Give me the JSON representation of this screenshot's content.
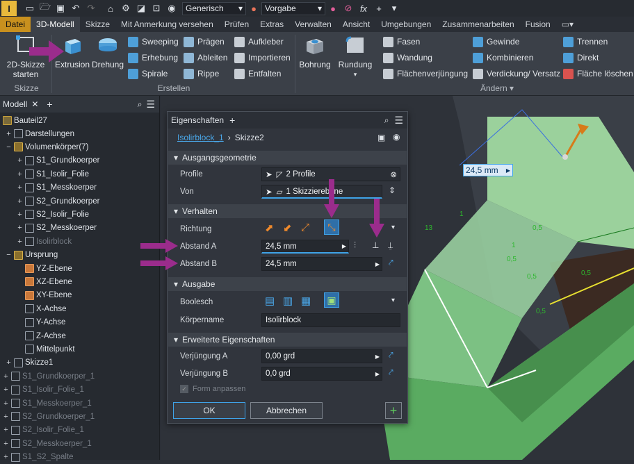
{
  "qat": {
    "logo": "I",
    "style_select": "Generisch",
    "appearance_select": "Vorgabe",
    "fx": "fx"
  },
  "tabs": [
    "Datei",
    "3D-Modell",
    "Skizze",
    "Mit Anmerkung versehen",
    "Prüfen",
    "Extras",
    "Verwalten",
    "Ansicht",
    "Umgebungen",
    "Zusammenarbeiten",
    "Fusion"
  ],
  "ribbon": {
    "skizze": {
      "start_line1": "2D-Skizze",
      "start_line2": "starten",
      "group": "Skizze"
    },
    "erstellen": {
      "extrusion": "Extrusion",
      "drehung": "Drehung",
      "sweeping": "Sweeping",
      "erhebung": "Erhebung",
      "spirale": "Spirale",
      "praegen": "Prägen",
      "ableiten": "Ableiten",
      "rippe": "Rippe",
      "aufkleber": "Aufkleber",
      "importieren": "Importieren",
      "entfalten": "Entfalten",
      "group": "Erstellen"
    },
    "aendern": {
      "bohrung": "Bohrung",
      "rundung": "Rundung",
      "fasen": "Fasen",
      "wandung": "Wandung",
      "flaechenverjuengung": "Flächenverjüngung",
      "gewinde": "Gewinde",
      "kombinieren": "Kombinieren",
      "verdickung": "Verdickung/ Versatz",
      "trennen": "Trennen",
      "direkt": "Direkt",
      "flaeche_loeschen": "Fläche löschen",
      "group": "Ändern"
    }
  },
  "browser": {
    "tab": "Modell",
    "root": "Bauteil27",
    "items": [
      {
        "label": "Darstellungen",
        "level": 1,
        "dim": false
      },
      {
        "label": "Volumenkörper(7)",
        "level": 1,
        "dim": false
      },
      {
        "label": "S1_Grundkoerper",
        "level": 2,
        "dim": false
      },
      {
        "label": "S1_Isolir_Folie",
        "level": 2,
        "dim": false
      },
      {
        "label": "S1_Messkoerper",
        "level": 2,
        "dim": false
      },
      {
        "label": "S2_Grundkoerper",
        "level": 2,
        "dim": false
      },
      {
        "label": "S2_Isolir_Folie",
        "level": 2,
        "dim": false
      },
      {
        "label": "S2_Messkoerper",
        "level": 2,
        "dim": false
      },
      {
        "label": "Isolirblock",
        "level": 2,
        "dim": true
      },
      {
        "label": "Ursprung",
        "level": 1,
        "dim": false
      },
      {
        "label": "YZ-Ebene",
        "level": 2,
        "dim": false
      },
      {
        "label": "XZ-Ebene",
        "level": 2,
        "dim": false
      },
      {
        "label": "XY-Ebene",
        "level": 2,
        "dim": false
      },
      {
        "label": "X-Achse",
        "level": 2,
        "dim": false
      },
      {
        "label": "Y-Achse",
        "level": 2,
        "dim": false
      },
      {
        "label": "Z-Achse",
        "level": 2,
        "dim": false
      },
      {
        "label": "Mittelpunkt",
        "level": 2,
        "dim": false
      },
      {
        "label": "Skizze1",
        "level": 1,
        "dim": false
      },
      {
        "label": "S1_Grundkoerper_1",
        "level": 0,
        "dim": true
      },
      {
        "label": "S1_Isolir_Folie_1",
        "level": 0,
        "dim": true
      },
      {
        "label": "S1_Messkoerper_1",
        "level": 0,
        "dim": true
      },
      {
        "label": "S2_Grundkoerper_1",
        "level": 0,
        "dim": true
      },
      {
        "label": "S2_Isolir_Folie_1",
        "level": 0,
        "dim": true
      },
      {
        "label": "S2_Messkoerper_1",
        "level": 0,
        "dim": true
      },
      {
        "label": "S1_S2_Spalte",
        "level": 0,
        "dim": true
      }
    ]
  },
  "props": {
    "tab": "Eigenschaften",
    "breadcrumb_link": "Isolirblock_1",
    "breadcrumb_current": "Skizze2",
    "ausgang": {
      "title": "Ausgangsgeometrie",
      "profile_label": "Profile",
      "profile_value": "2 Profile",
      "von_label": "Von",
      "von_value": "1 Skizzierebene"
    },
    "verhalten": {
      "title": "Verhalten",
      "richtung_label": "Richtung",
      "abstand_a_label": "Abstand A",
      "abstand_a_value": "24,5 mm",
      "abstand_b_label": "Abstand B",
      "abstand_b_value": "24,5 mm"
    },
    "ausgabe": {
      "title": "Ausgabe",
      "boolesch_label": "Boolesch",
      "koerpername_label": "Körpername",
      "koerpername_value": "Isolirblock"
    },
    "erweitert": {
      "title": "Erweiterte Eigenschaften",
      "verj_a_label": "Verjüngung A",
      "verj_a_value": "0,00 grd",
      "verj_b_label": "Verjüngung B",
      "verj_b_value": "0,0 grd",
      "form_anpassen": "Form anpassen"
    },
    "ok": "OK",
    "cancel": "Abbrechen"
  },
  "viewport": {
    "dimension_value": "24,5 mm",
    "labels": [
      "13",
      "1",
      "0,5",
      "1",
      "0,5",
      "0,5",
      "0,5",
      "0,5"
    ]
  },
  "colors": {
    "accent": "#3fa3e8",
    "annotation_arrow": "#9b2c8c",
    "model_green": "#86c98a",
    "sketch_green": "#2eb82e"
  }
}
